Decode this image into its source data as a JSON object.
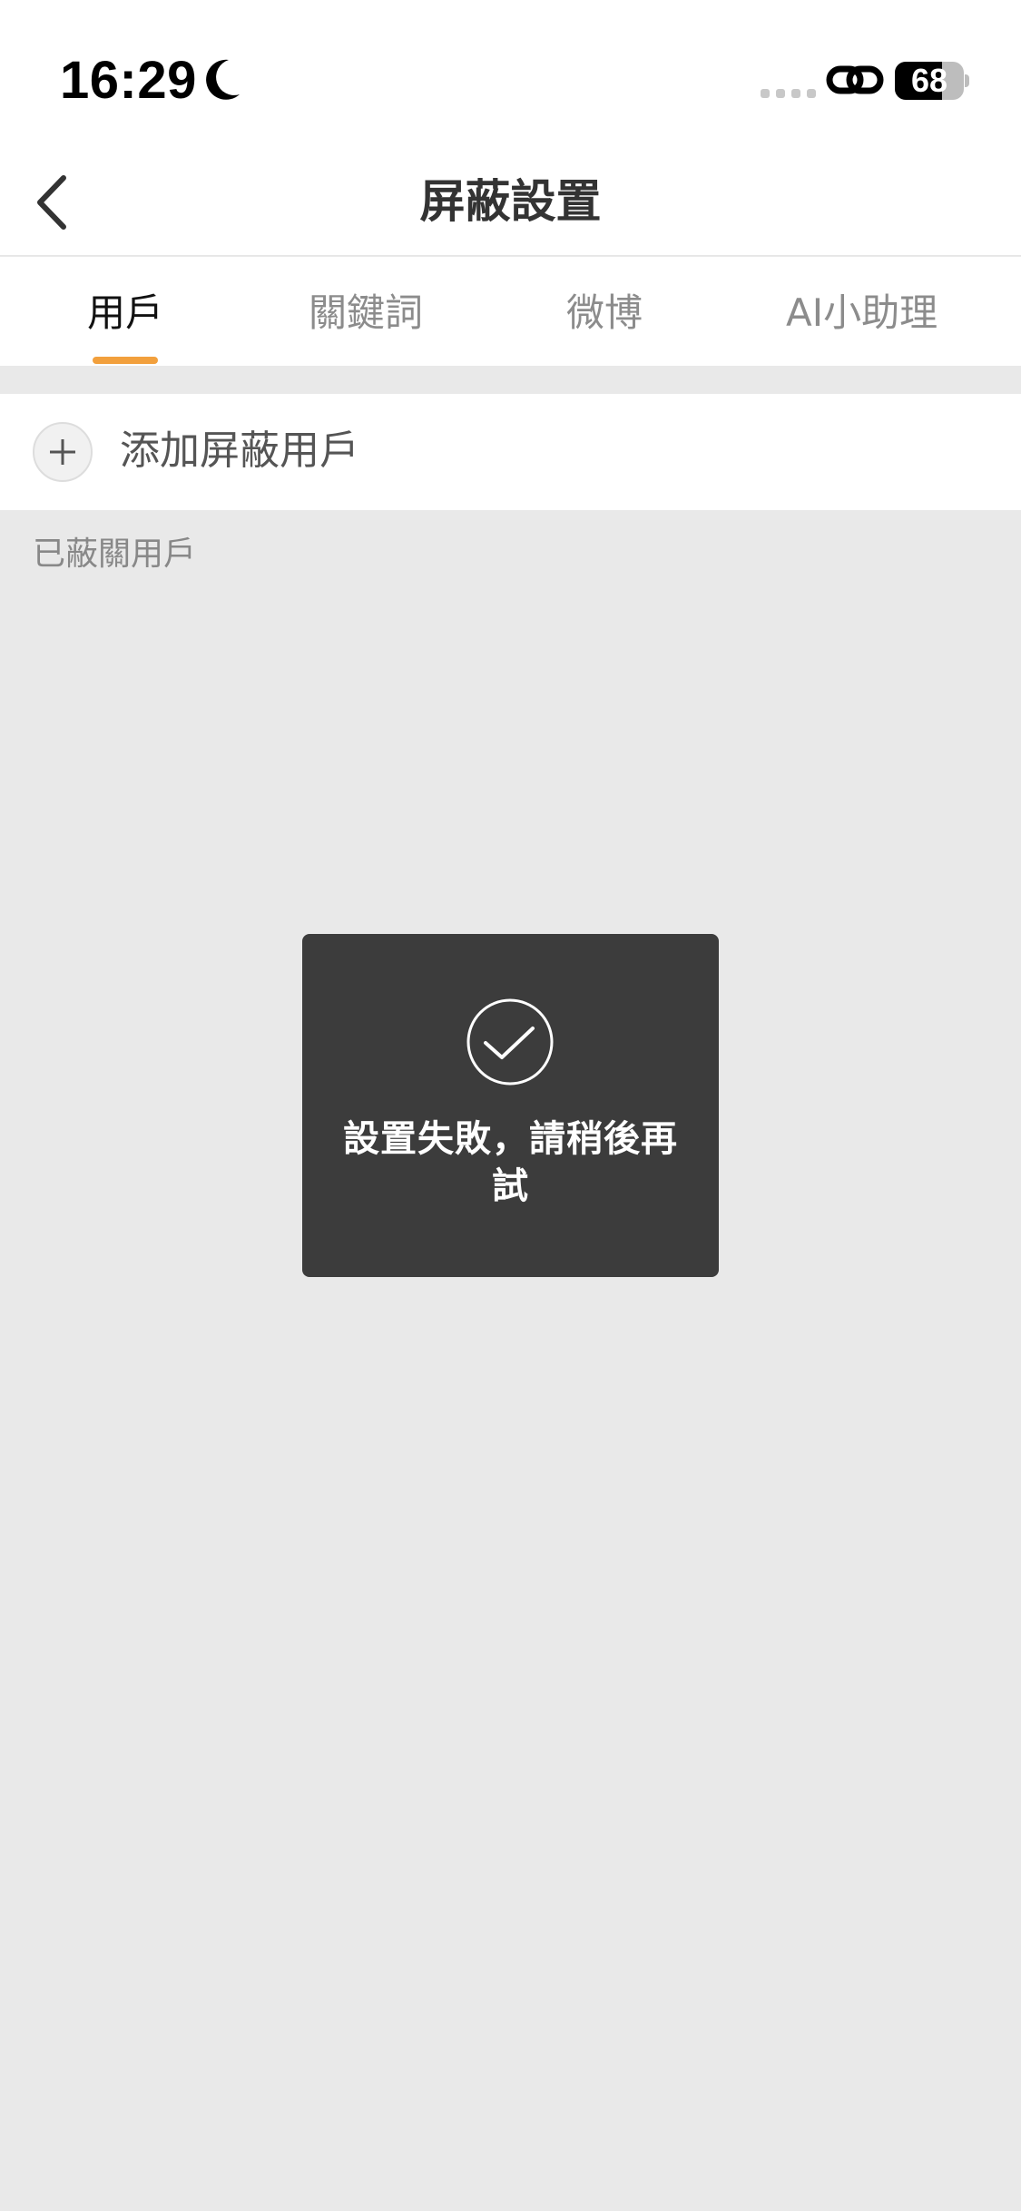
{
  "status_bar": {
    "time": "16:29",
    "battery_percent": "68",
    "battery_level": 0.68,
    "icons": [
      "moon-icon",
      "signal-icon",
      "link-icon",
      "battery-icon"
    ]
  },
  "nav": {
    "title": "屏蔽設置",
    "back_icon": "chevron-left-icon"
  },
  "tabs": [
    {
      "label": "用戶",
      "active": true
    },
    {
      "label": "關鍵詞",
      "active": false
    },
    {
      "label": "微博",
      "active": false
    },
    {
      "label": "AI小助理",
      "active": false
    }
  ],
  "add_row": {
    "label": "添加屏蔽用戶",
    "icon": "plus-icon"
  },
  "section": {
    "label": "已蔽關用戶"
  },
  "toast": {
    "icon": "check-icon",
    "message": "設置失敗，請稍後再試"
  },
  "colors": {
    "accent": "#f2a03d",
    "background": "#e9e9e9",
    "toast_background": "#3c3c3c"
  }
}
